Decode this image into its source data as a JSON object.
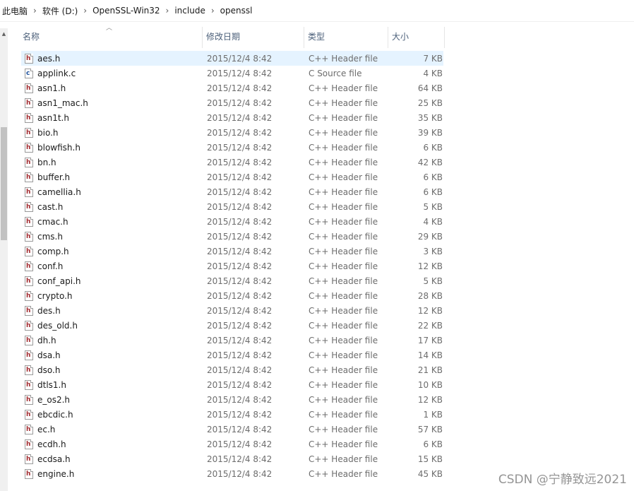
{
  "breadcrumb": [
    "此电脑",
    "软件 (D:)",
    "OpenSSL-Win32",
    "include",
    "openssl"
  ],
  "breadcrumb_separator": "›",
  "columns": {
    "name": "名称",
    "date": "修改日期",
    "type": "类型",
    "size": "大小"
  },
  "files": [
    {
      "name": "aes.h",
      "date": "2015/12/4 8:42",
      "type": "C++ Header file",
      "size": "7 KB",
      "icon": "h-file-icon",
      "selected": true
    },
    {
      "name": "applink.c",
      "date": "2015/12/4 8:42",
      "type": "C Source file",
      "size": "4 KB",
      "icon": "c-file-icon"
    },
    {
      "name": "asn1.h",
      "date": "2015/12/4 8:42",
      "type": "C++ Header file",
      "size": "64 KB",
      "icon": "h-file-icon"
    },
    {
      "name": "asn1_mac.h",
      "date": "2015/12/4 8:42",
      "type": "C++ Header file",
      "size": "25 KB",
      "icon": "h-file-icon"
    },
    {
      "name": "asn1t.h",
      "date": "2015/12/4 8:42",
      "type": "C++ Header file",
      "size": "35 KB",
      "icon": "h-file-icon"
    },
    {
      "name": "bio.h",
      "date": "2015/12/4 8:42",
      "type": "C++ Header file",
      "size": "39 KB",
      "icon": "h-file-icon"
    },
    {
      "name": "blowfish.h",
      "date": "2015/12/4 8:42",
      "type": "C++ Header file",
      "size": "6 KB",
      "icon": "h-file-icon"
    },
    {
      "name": "bn.h",
      "date": "2015/12/4 8:42",
      "type": "C++ Header file",
      "size": "42 KB",
      "icon": "h-file-icon"
    },
    {
      "name": "buffer.h",
      "date": "2015/12/4 8:42",
      "type": "C++ Header file",
      "size": "6 KB",
      "icon": "h-file-icon"
    },
    {
      "name": "camellia.h",
      "date": "2015/12/4 8:42",
      "type": "C++ Header file",
      "size": "6 KB",
      "icon": "h-file-icon"
    },
    {
      "name": "cast.h",
      "date": "2015/12/4 8:42",
      "type": "C++ Header file",
      "size": "5 KB",
      "icon": "h-file-icon"
    },
    {
      "name": "cmac.h",
      "date": "2015/12/4 8:42",
      "type": "C++ Header file",
      "size": "4 KB",
      "icon": "h-file-icon"
    },
    {
      "name": "cms.h",
      "date": "2015/12/4 8:42",
      "type": "C++ Header file",
      "size": "29 KB",
      "icon": "h-file-icon"
    },
    {
      "name": "comp.h",
      "date": "2015/12/4 8:42",
      "type": "C++ Header file",
      "size": "3 KB",
      "icon": "h-file-icon"
    },
    {
      "name": "conf.h",
      "date": "2015/12/4 8:42",
      "type": "C++ Header file",
      "size": "12 KB",
      "icon": "h-file-icon"
    },
    {
      "name": "conf_api.h",
      "date": "2015/12/4 8:42",
      "type": "C++ Header file",
      "size": "5 KB",
      "icon": "h-file-icon"
    },
    {
      "name": "crypto.h",
      "date": "2015/12/4 8:42",
      "type": "C++ Header file",
      "size": "28 KB",
      "icon": "h-file-icon"
    },
    {
      "name": "des.h",
      "date": "2015/12/4 8:42",
      "type": "C++ Header file",
      "size": "12 KB",
      "icon": "h-file-icon"
    },
    {
      "name": "des_old.h",
      "date": "2015/12/4 8:42",
      "type": "C++ Header file",
      "size": "22 KB",
      "icon": "h-file-icon"
    },
    {
      "name": "dh.h",
      "date": "2015/12/4 8:42",
      "type": "C++ Header file",
      "size": "17 KB",
      "icon": "h-file-icon"
    },
    {
      "name": "dsa.h",
      "date": "2015/12/4 8:42",
      "type": "C++ Header file",
      "size": "14 KB",
      "icon": "h-file-icon"
    },
    {
      "name": "dso.h",
      "date": "2015/12/4 8:42",
      "type": "C++ Header file",
      "size": "21 KB",
      "icon": "h-file-icon"
    },
    {
      "name": "dtls1.h",
      "date": "2015/12/4 8:42",
      "type": "C++ Header file",
      "size": "10 KB",
      "icon": "h-file-icon"
    },
    {
      "name": "e_os2.h",
      "date": "2015/12/4 8:42",
      "type": "C++ Header file",
      "size": "12 KB",
      "icon": "h-file-icon"
    },
    {
      "name": "ebcdic.h",
      "date": "2015/12/4 8:42",
      "type": "C++ Header file",
      "size": "1 KB",
      "icon": "h-file-icon"
    },
    {
      "name": "ec.h",
      "date": "2015/12/4 8:42",
      "type": "C++ Header file",
      "size": "57 KB",
      "icon": "h-file-icon"
    },
    {
      "name": "ecdh.h",
      "date": "2015/12/4 8:42",
      "type": "C++ Header file",
      "size": "6 KB",
      "icon": "h-file-icon"
    },
    {
      "name": "ecdsa.h",
      "date": "2015/12/4 8:42",
      "type": "C++ Header file",
      "size": "15 KB",
      "icon": "h-file-icon"
    },
    {
      "name": "engine.h",
      "date": "2015/12/4 8:42",
      "type": "C++ Header file",
      "size": "45 KB",
      "icon": "h-file-icon"
    }
  ],
  "watermark": "CSDN @宁静致远2021",
  "colors": {
    "selection": "#e5f3ff",
    "header_text": "#4c607a",
    "meta_text": "#6d6d6d",
    "h_glyph": "#a0282d",
    "c_glyph": "#1c4f9c"
  }
}
